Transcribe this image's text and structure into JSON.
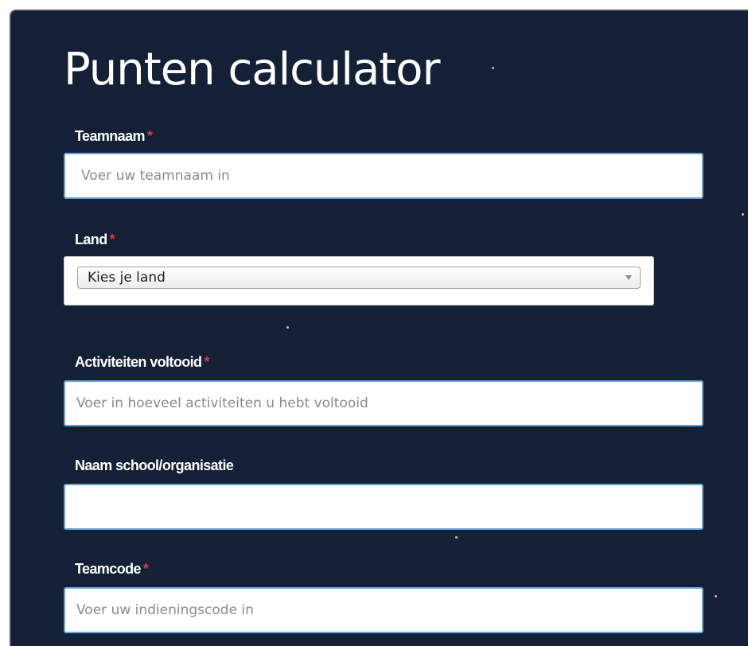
{
  "form": {
    "title": "Punten calculator",
    "required_marker": "*",
    "team_name": {
      "label": "Teamnaam",
      "placeholder": "Voer uw teamnaam in",
      "value": ""
    },
    "country": {
      "label": "Land",
      "selected": "Kies je land"
    },
    "activities": {
      "label": "Activiteiten voltooid",
      "placeholder": "Voer in hoeveel activiteiten u hebt voltooid",
      "value": ""
    },
    "school": {
      "label": "Naam school/organisatie",
      "placeholder": "",
      "value": ""
    },
    "team_code": {
      "label": "Teamcode",
      "placeholder": "Voer uw indieningscode in",
      "value": ""
    }
  },
  "colors": {
    "background": "#132035",
    "required": "#e0344a",
    "input_border": "#6aa2d8",
    "star_dot": "#d8c27a"
  }
}
